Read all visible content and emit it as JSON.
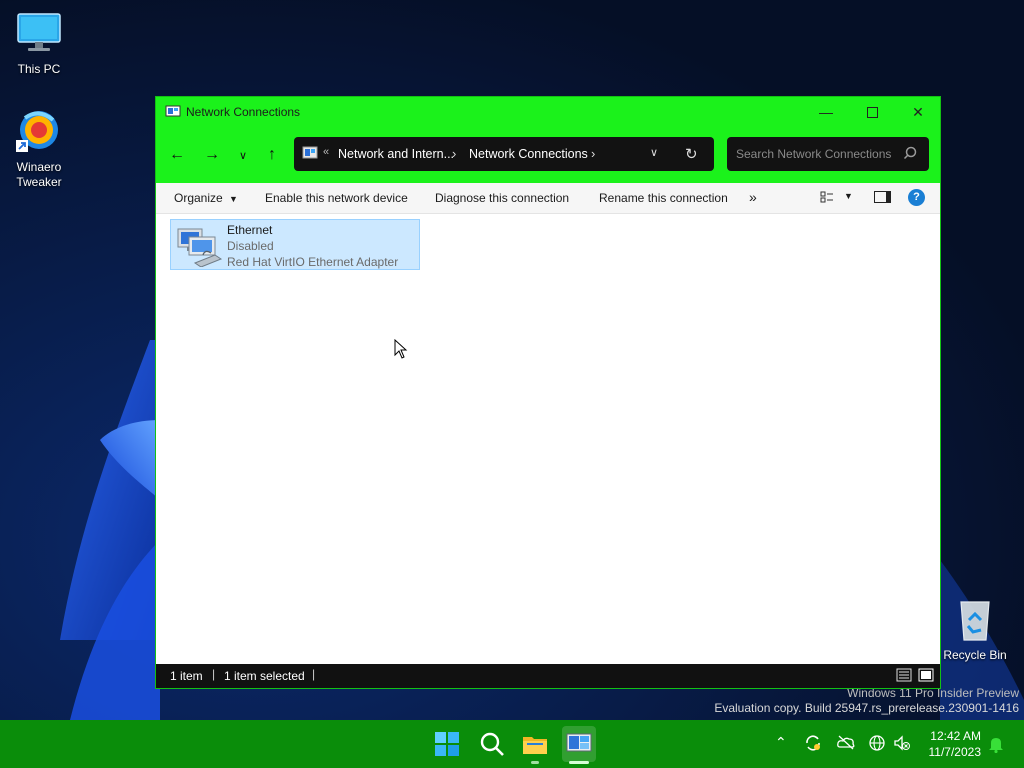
{
  "desktop": {
    "icons": [
      {
        "label": "This PC",
        "icon": "monitor-icon"
      },
      {
        "label": "Winaero\nTweaker",
        "icon": "winaero-tweaker-icon"
      },
      {
        "label": "Recycle Bin",
        "icon": "recycle-bin-icon"
      }
    ],
    "watermark": {
      "line1": "Windows 11 Pro Insider Preview",
      "line2": "Evaluation copy. Build 25947.rs_prerelease.230901-1416"
    }
  },
  "window": {
    "title": "Network Connections",
    "address": {
      "overflow": "«",
      "crumbs": [
        "Network and Intern...",
        "Network Connections"
      ]
    },
    "search": {
      "placeholder": "Search Network Connections"
    },
    "commands": {
      "organize": "Organize",
      "enable": "Enable this network device",
      "diagnose": "Diagnose this connection",
      "rename": "Rename this connection",
      "more": "»"
    },
    "items": [
      {
        "name": "Ethernet",
        "status": "Disabled",
        "device": "Red Hat VirtIO Ethernet Adapter"
      }
    ],
    "statusbar": {
      "count": "1 item",
      "selected": "1 item selected"
    }
  },
  "taskbar": {
    "clock": {
      "time": "12:42 AM",
      "date": "11/7/2023"
    }
  },
  "colors": {
    "titlebar": "#1bf21b",
    "taskbar": "#0a8d0a",
    "selection": "#cce8ff",
    "help": "#1a7fd4"
  }
}
